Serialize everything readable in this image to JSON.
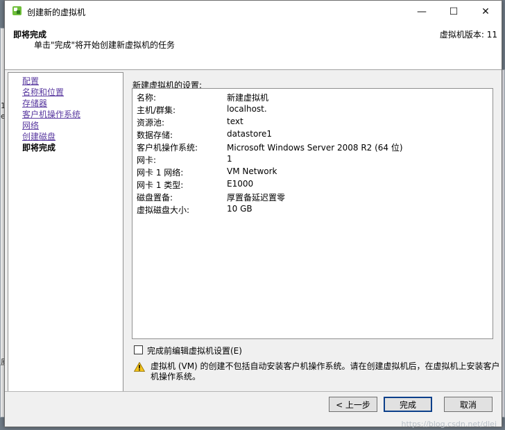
{
  "window": {
    "title": "创建新的虚拟机",
    "minimize_glyph": "—",
    "maximize_glyph": "☐",
    "close_glyph": "✕"
  },
  "header": {
    "title": "即将完成",
    "subtitle": "单击\"完成\"将开始创建新虚拟机的任务",
    "version": "虚拟机版本: 11"
  },
  "nav": {
    "items": [
      {
        "label": "配置"
      },
      {
        "label": "名称和位置"
      },
      {
        "label": "存储器"
      },
      {
        "label": "客户机操作系统"
      },
      {
        "label": "网络"
      },
      {
        "label": "创建磁盘"
      },
      {
        "label": "即将完成",
        "current": true
      }
    ]
  },
  "settings": {
    "label": "新建虚拟机的设置:",
    "rows": [
      {
        "key": "名称:",
        "value": "新建虚拟机"
      },
      {
        "key": "主机/群集:",
        "value": "localhost."
      },
      {
        "key": "资源池:",
        "value": "text"
      },
      {
        "key": "数据存储:",
        "value": "datastore1"
      },
      {
        "key": "客户机操作系统:",
        "value": "Microsoft Windows Server 2008 R2 (64 位)"
      },
      {
        "key": "网卡:",
        "value": "1"
      },
      {
        "key": "网卡 1 网络:",
        "value": "VM Network"
      },
      {
        "key": "网卡 1 类型:",
        "value": "E1000"
      },
      {
        "key": "磁盘置备:",
        "value": "厚置备延迟置零"
      },
      {
        "key": "虚拟磁盘大小:",
        "value": "10 GB"
      }
    ]
  },
  "edit_checkbox": {
    "label": "完成前编辑虚拟机设置(E)",
    "checked": false
  },
  "warning": {
    "icon": "warning-icon",
    "text": "虚拟机 (VM) 的创建不包括自动安装客户机操作系统。请在创建虚拟机后，在虚拟机上安装客户机操作系统。"
  },
  "buttons": {
    "back": "< 上一步",
    "finish": "完成",
    "cancel": "取消"
  },
  "background": {
    "left_fragments": [
      "16",
      "ex",
      "原"
    ]
  },
  "watermark": "https://blog.csdn.net/dlei"
}
